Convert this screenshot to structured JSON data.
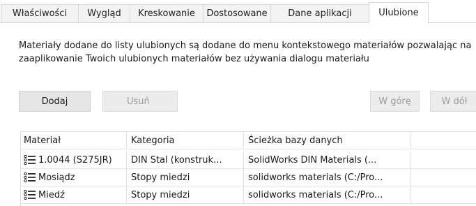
{
  "tabs": [
    {
      "label": "Właściwości"
    },
    {
      "label": "Wygląd"
    },
    {
      "label": "Kreskowanie"
    },
    {
      "label": "Dostosowane"
    },
    {
      "label": "Dane aplikacji"
    },
    {
      "label": "Ulubione",
      "active": true
    }
  ],
  "description": "Materiały dodane do listy ulubionych są dodane do menu kontekstowego materiałów pozwalając na zaaplikowanie Twoich ulubionych materiałów bez używania dialogu materiału",
  "buttons": {
    "add": "Dodaj",
    "remove": "Usuń",
    "up": "W górę",
    "down": "W dół"
  },
  "table": {
    "headers": [
      "Materiał",
      "Kategoria",
      "Ścieżka bazy danych"
    ],
    "rows": [
      {
        "material": "1.0044 (S275JR)",
        "category": "DIN Stal (konstruk...",
        "path": "SolidWorks DIN Materials (..."
      },
      {
        "material": "Mosiądz",
        "category": "Stopy miedzi",
        "path": "solidworks materials (C:/Pro..."
      },
      {
        "material": "Miedź",
        "category": "Stopy miedzi",
        "path": "solidworks materials (C:/Pro..."
      }
    ],
    "row_icon": "list-icon"
  },
  "colors": {
    "button_bg": "#e6e6e6",
    "disabled_text": "#9c9c9c",
    "tab_inactive_bg": "#f3f3f3",
    "border": "#d6d6d6"
  }
}
